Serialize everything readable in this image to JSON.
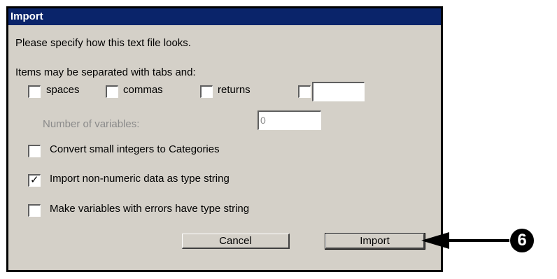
{
  "dialog": {
    "title": "Import",
    "instruction": "Please specify how this text file looks.",
    "separator_label": "Items may be separated with tabs and:",
    "separators": [
      {
        "label": "spaces",
        "checked": false
      },
      {
        "label": "commas",
        "checked": false
      },
      {
        "label": "returns",
        "checked": false
      },
      {
        "label": "",
        "checked": false
      }
    ],
    "custom_separator_value": "",
    "num_variables_label": "Number of variables:",
    "num_variables_value": "0",
    "options": [
      {
        "label": "Convert small integers to Categories",
        "checked": false
      },
      {
        "label": "Import non-numeric data as type string",
        "checked": true
      },
      {
        "label": "Make variables with errors have type string",
        "checked": false
      }
    ],
    "cancel_label": "Cancel",
    "import_label": "Import"
  },
  "callout": {
    "number": "6"
  },
  "colors": {
    "titlebar": "#0a246a",
    "dialog_bg": "#d4d0c8"
  }
}
